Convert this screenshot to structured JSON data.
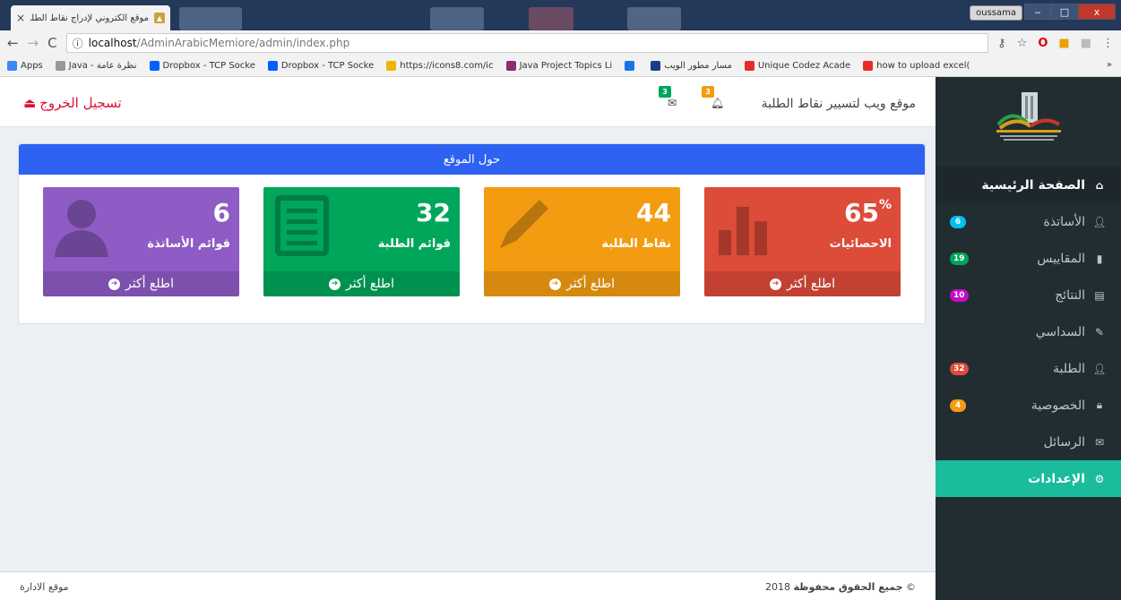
{
  "browser": {
    "tab_title": "موقع الكتروني لإدراج نقاط الطلبة",
    "tab_close": "×",
    "profile": "oussama",
    "win_min": "‒",
    "win_max": "□",
    "win_close": "x",
    "url_info": "ⓘ",
    "url_host": "localhost",
    "url_path": "/AdminArabicMemiore/admin/index.php",
    "back": "←",
    "forward": "→",
    "reload": "C",
    "more": "⋮"
  },
  "bookmarks": {
    "items": [
      {
        "label": "Apps",
        "color": "#4285f4"
      },
      {
        "label": "Java - نظرة عامة",
        "color": "#999999"
      },
      {
        "label": "Dropbox - TCP Socke",
        "color": "#0061ff"
      },
      {
        "label": "Dropbox - TCP Socke",
        "color": "#0061ff"
      },
      {
        "label": "https://icons8.com/ic",
        "color": "#f0b400"
      },
      {
        "label": "Java Project Topics Li",
        "color": "#8e2a72"
      },
      {
        "label": "",
        "color": "#1a73e8"
      },
      {
        "label": "مسار مطور الويب",
        "color": "#1a3c8a"
      },
      {
        "label": "Unique Codez Acade",
        "color": "#e52d27"
      },
      {
        "label": "how to upload excel(",
        "color": "#e52d27"
      }
    ],
    "overflow": "»"
  },
  "header": {
    "logout_label": "تسجيل الخروج",
    "site_title": "موقع ويب لتسيير نقاط الطلبة",
    "messages_count": "3",
    "notifications_count": "3"
  },
  "panel": {
    "title": "حول الموقع",
    "more_label": "اطلع أكثر",
    "cards": [
      {
        "value": "6",
        "suffix": "",
        "label": "قوائم الأساتذة",
        "color": "#8e5cc4",
        "icon": "user-icon"
      },
      {
        "value": "32",
        "suffix": "",
        "label": "قوائم الطلبة",
        "color": "#00a65a",
        "icon": "list-icon"
      },
      {
        "value": "44",
        "suffix": "",
        "label": "نقاط الطلبة",
        "color": "#f39c12",
        "icon": "pencil-icon"
      },
      {
        "value": "65",
        "suffix": "%",
        "label": "الاحصائيات",
        "color": "#dd4b39",
        "icon": "bar-chart-icon"
      }
    ]
  },
  "sidebar": {
    "items": [
      {
        "label": "الصفحة الرئيسية",
        "icon": "home-icon",
        "badge": "",
        "badge_color": ""
      },
      {
        "label": "الأساتذة",
        "icon": "user-icon",
        "badge": "6",
        "badge_color": "#00c0ef"
      },
      {
        "label": "المقاييس",
        "icon": "book-icon",
        "badge": "19",
        "badge_color": "#00a65a"
      },
      {
        "label": "النتائج",
        "icon": "list-icon",
        "badge": "10",
        "badge_color": "#c20fc7"
      },
      {
        "label": "السداسي",
        "icon": "pencil-icon",
        "badge": "",
        "badge_color": ""
      },
      {
        "label": "الطلبة",
        "icon": "user-icon",
        "badge": "32",
        "badge_color": "#dd4b39"
      },
      {
        "label": "الخصوصية",
        "icon": "lock-icon",
        "badge": "4",
        "badge_color": "#f39c12"
      },
      {
        "label": "الرسائل",
        "icon": "envelope-icon",
        "badge": "",
        "badge_color": ""
      },
      {
        "label": "الإعدادات",
        "icon": "gear-icon",
        "badge": "",
        "badge_color": ""
      }
    ]
  },
  "footer": {
    "left": "موقع الادارة",
    "copyright_year": "2018 ©",
    "copyright_text": "جميع الحقوق محفوظة"
  }
}
